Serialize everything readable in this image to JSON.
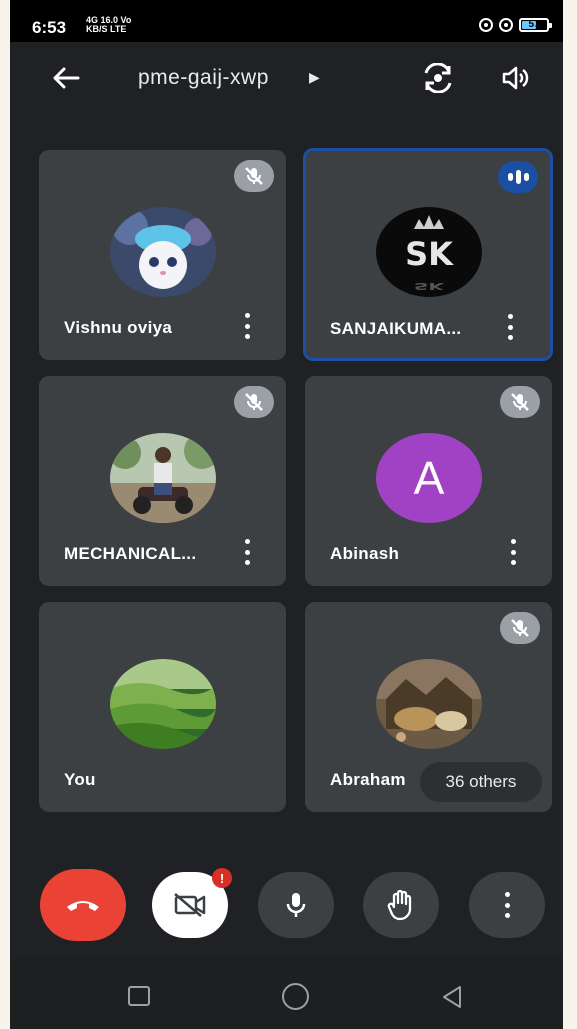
{
  "status_bar": {
    "time": "6:53",
    "network_line1": "4G 16.0 Vo",
    "network_line2": "KB/S LTE",
    "battery": "57",
    "battery_fraction": 0.57
  },
  "header": {
    "meeting_code": "pme-gaij-xwp",
    "icons": [
      "back-arrow-icon",
      "chevron-right-icon",
      "switch-camera-icon",
      "speaker-icon"
    ]
  },
  "participants": [
    {
      "name": "Vishnu oviya",
      "mic": "muted",
      "avatar": "photo"
    },
    {
      "name": "SANJAIKUMA...",
      "mic": "speaking",
      "avatar": "photo-sk-logo"
    },
    {
      "name": "MECHANICAL...",
      "mic": "muted",
      "avatar": "photo"
    },
    {
      "name": "Abinash",
      "mic": "muted",
      "avatar": "letter",
      "avatar_letter": "A",
      "avatar_color": "#a142c4"
    },
    {
      "name": "You",
      "mic": "unmuted",
      "avatar": "photo"
    },
    {
      "name": "Abraham",
      "mic": "muted",
      "avatar": "photo"
    }
  ],
  "others": {
    "label": "36 others"
  },
  "controls": {
    "alert_badge": "!",
    "buttons": [
      "end-call",
      "camera-off",
      "microphone",
      "raise-hand",
      "more-options"
    ]
  },
  "colors": {
    "background": "#202124",
    "tile": "#3c4043",
    "active_border": "#1a4fa3",
    "end_call": "#ea4335",
    "alert": "#d93025"
  }
}
